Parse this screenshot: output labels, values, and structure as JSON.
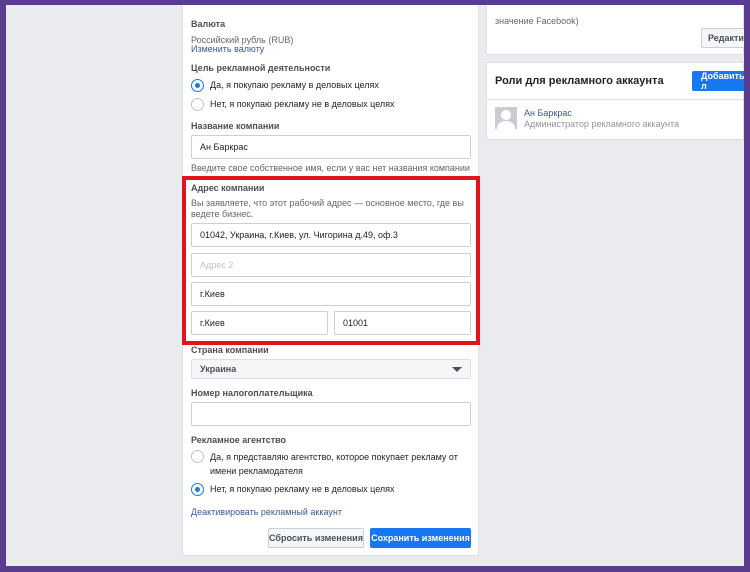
{
  "currency": {
    "label": "Валюта",
    "value": "Российский рубль (RUB)",
    "change_link": "Изменить валюту"
  },
  "ad_purpose": {
    "label": "Цель рекламной деятельности",
    "option_yes": "Да, я покупаю рекламу в деловых целях",
    "option_no": "Нет, я покупаю рекламу не в деловых целях",
    "selected": "yes"
  },
  "company_name": {
    "label": "Название компании",
    "value": "Ан Баркрас",
    "hint": "Введите свое собственное имя, если у вас нет названия компании"
  },
  "company_address": {
    "label": "Адрес компании",
    "description": "Вы заявляете, что этот рабочий адрес — основное место, где вы ведете бизнес.",
    "address1": "01042, Украина, г.Киев, ул. Чигорина д.49, оф.3",
    "address2_placeholder": "Адрес 2",
    "city": "г.Киев",
    "region": "г.Киев",
    "zip": "01001"
  },
  "country": {
    "label": "Страна компании",
    "value": "Украина"
  },
  "tax_id": {
    "label": "Номер налогоплательщика",
    "value": ""
  },
  "agency": {
    "label": "Рекламное агентство",
    "option_yes": "Да, я представляю агентство, которое покупает рекламу от имени рекламодателя",
    "option_no": "Нет, я покупаю рекламу не в деловых целях",
    "selected": "no"
  },
  "deactivate_link": "Деактивировать рекламный аккаунт",
  "buttons": {
    "reset": "Сбросить изменения",
    "save": "Сохранить изменения"
  },
  "right_top": {
    "text": "значение Facebook)",
    "edit_button": "Редактир"
  },
  "roles": {
    "title": "Роли для рекламного аккаунта",
    "add_button": "Добавить л",
    "user_name": "Ан Баркрас",
    "user_role": "Администратор рекламного аккаунта"
  },
  "colors": {
    "accent": "#1877f2",
    "highlight": "#e0141f",
    "frame": "#5b3d90"
  }
}
